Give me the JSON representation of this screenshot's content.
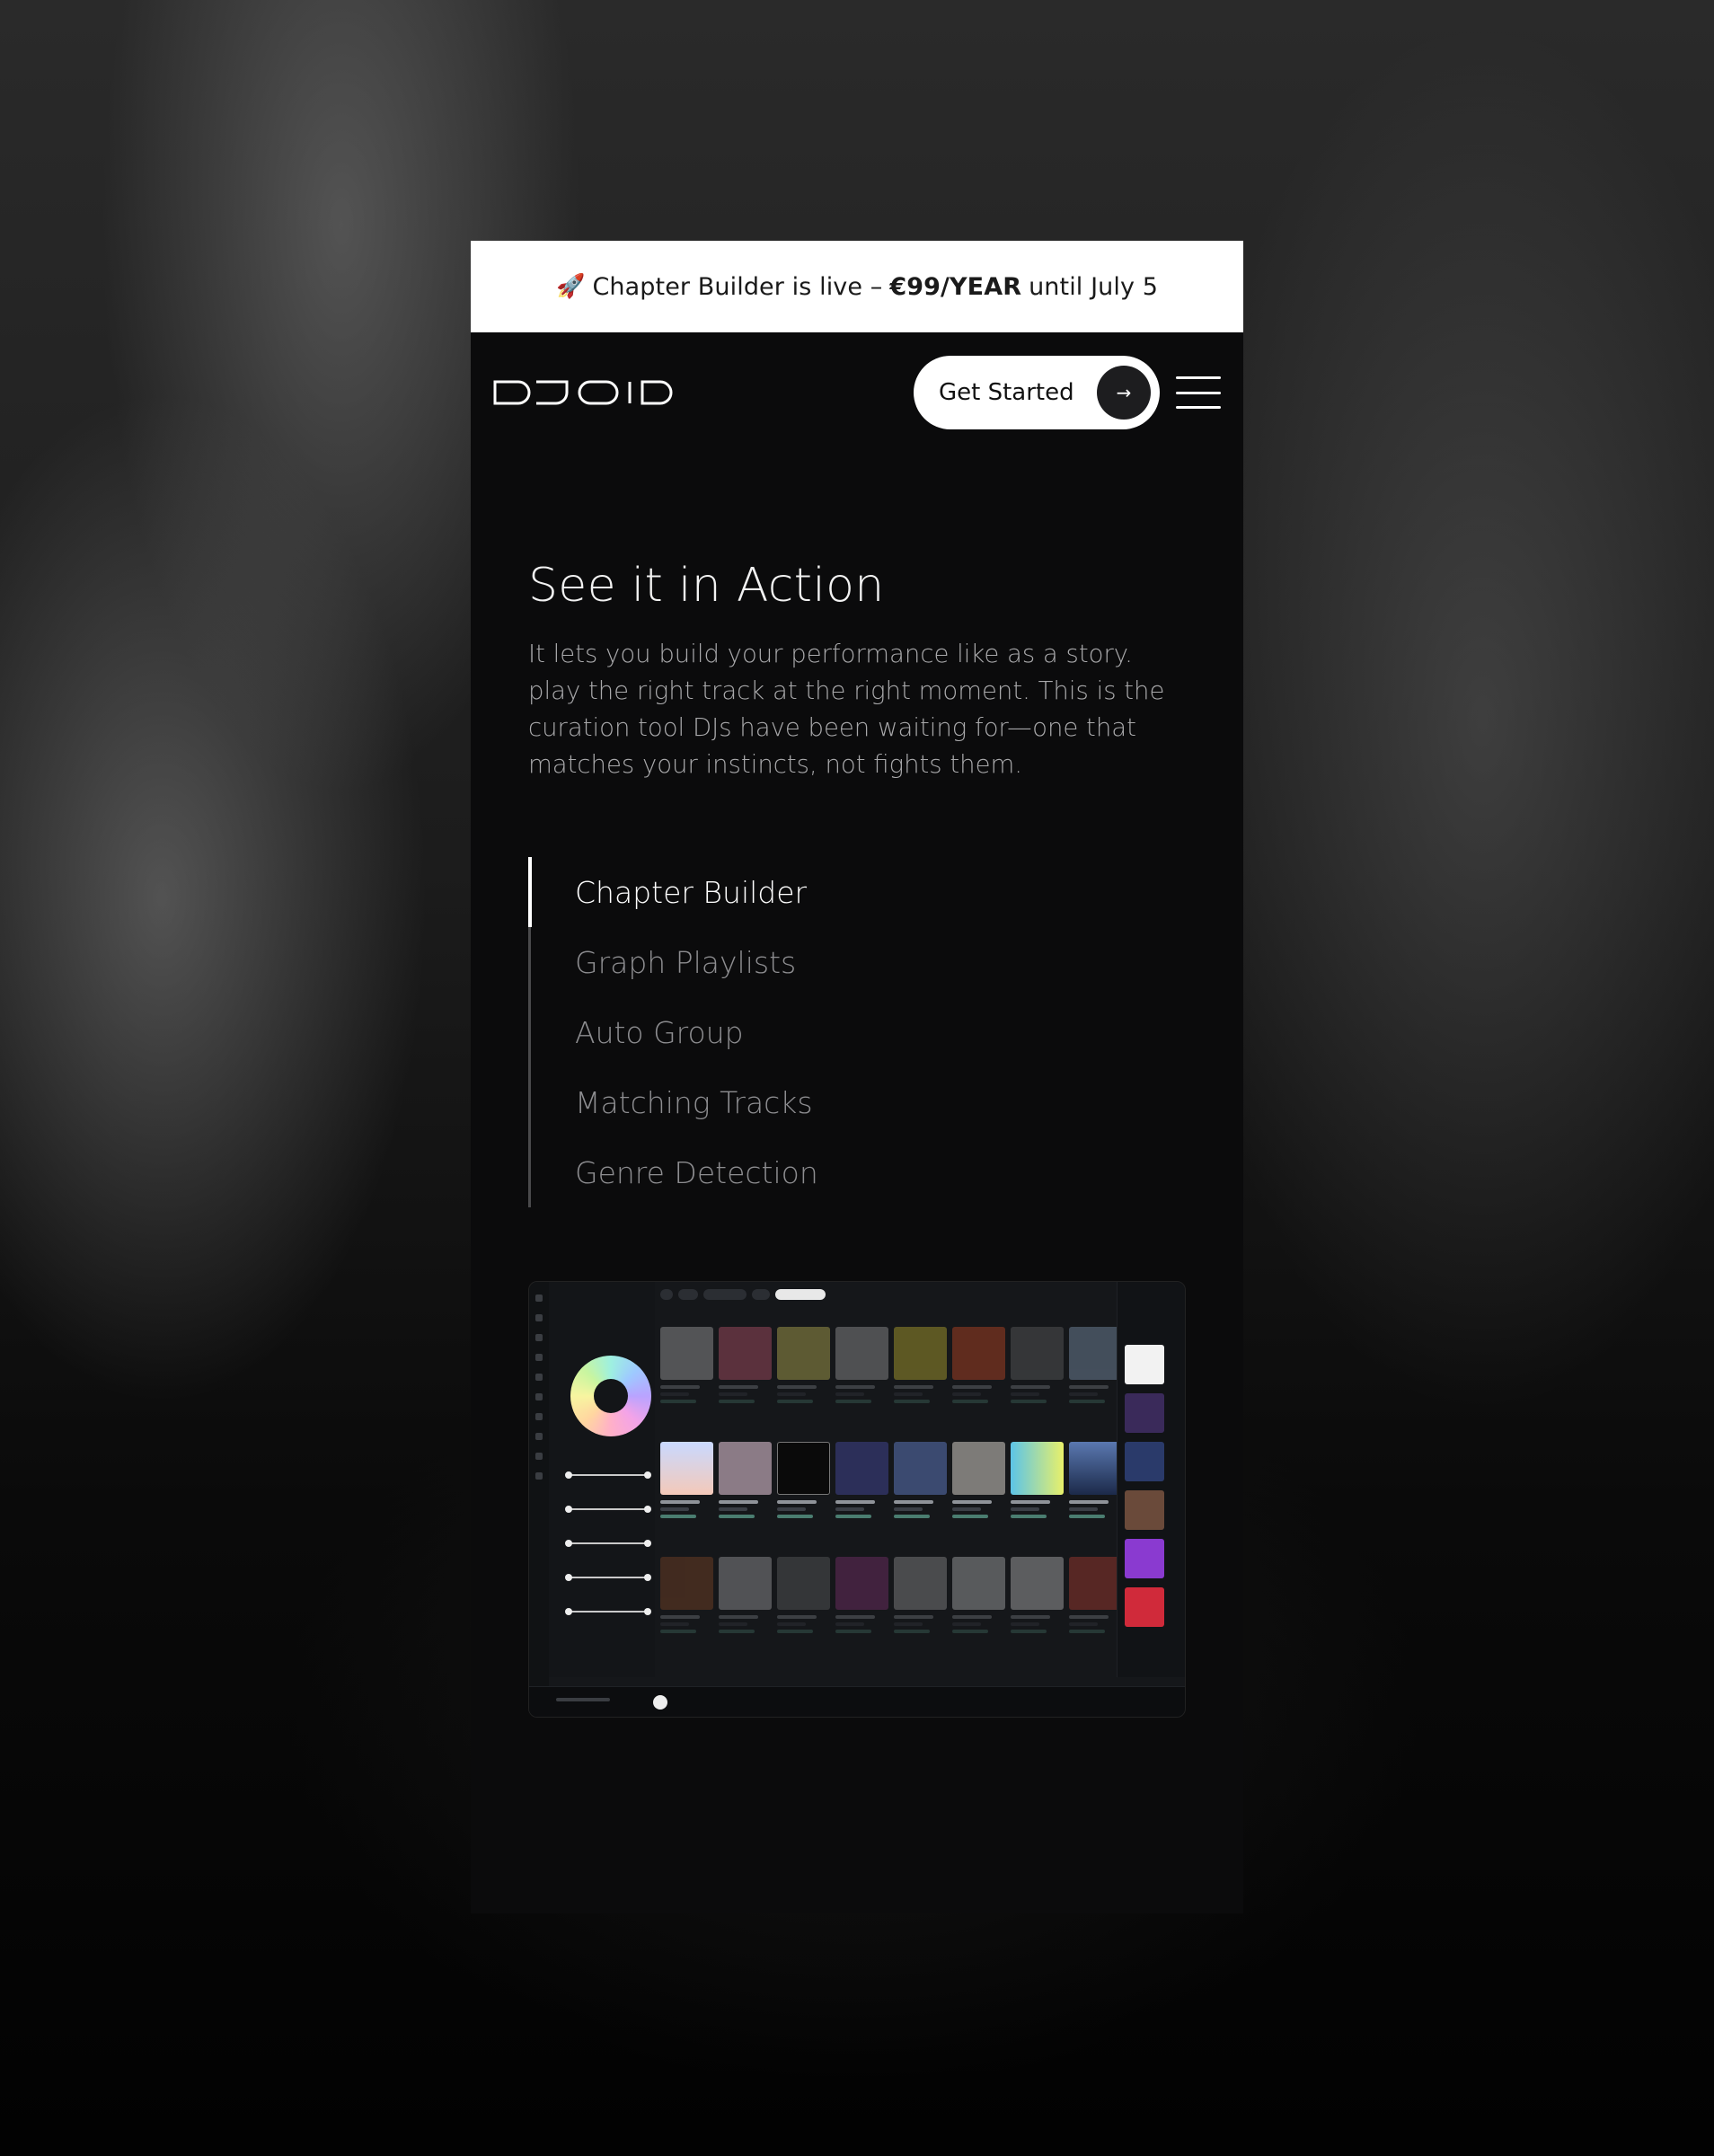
{
  "promo": {
    "icon": "rocket-icon",
    "text_before": "Chapter Builder is live –",
    "price": "€99/YEAR",
    "text_after": "until July 5"
  },
  "nav": {
    "logo_alt": "DJOID",
    "cta_label": "Get Started",
    "cta_icon": "arrow-right-icon",
    "menu_icon": "hamburger-menu-icon"
  },
  "section": {
    "title": "See it in Action",
    "description": "It lets you build your performance like as a story. play the right track at the right moment. This is the curation tool DJs have been waiting for—one that matches your instincts, not fights them."
  },
  "tabs": [
    {
      "label": "Chapter Builder",
      "active": true
    },
    {
      "label": "Graph Playlists",
      "active": false
    },
    {
      "label": "Auto Group",
      "active": false
    },
    {
      "label": "Matching Tracks",
      "active": false
    },
    {
      "label": "Genre Detection",
      "active": false
    }
  ],
  "colors": {
    "background": "#0b0b0c",
    "promo_bg": "#ffffff",
    "active_tab": "#ffffff",
    "inactive_tab": "#8d8d90",
    "body_text": "#a9a9ab"
  }
}
